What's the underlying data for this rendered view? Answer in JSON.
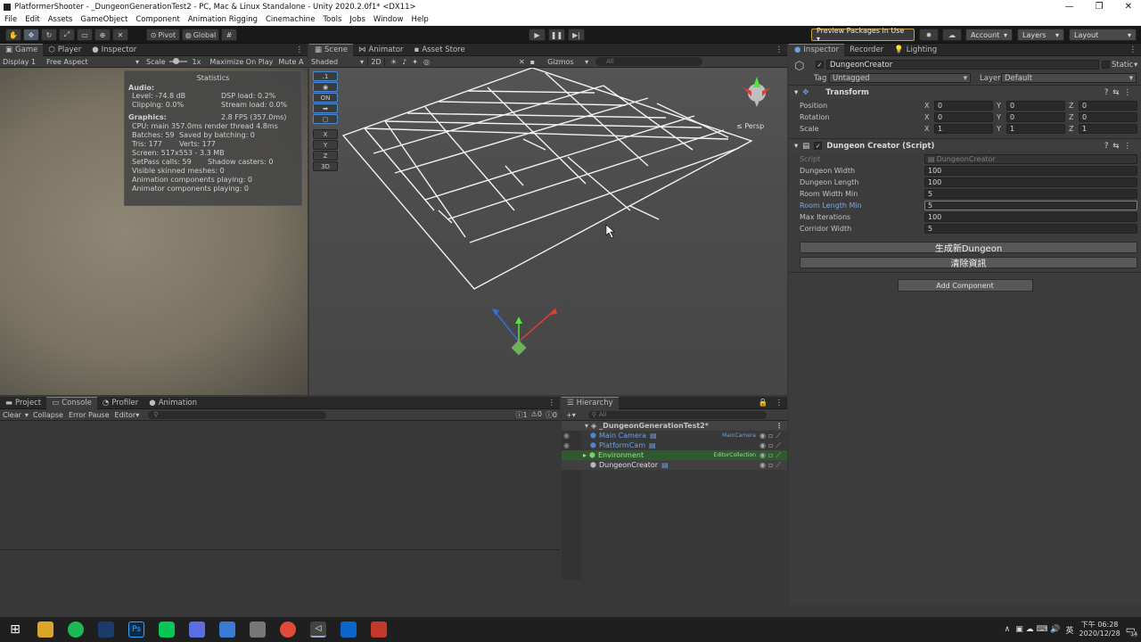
{
  "window": {
    "title": "PlatformerShooter - _DungeonGenerationTest2 - PC, Mac & Linux Standalone - Unity 2020.2.0f1* <DX11>",
    "controls": [
      "—",
      "❐",
      "✕"
    ]
  },
  "menu": [
    "File",
    "Edit",
    "Assets",
    "GameObject",
    "Component",
    "Animation Rigging",
    "Cinemachine",
    "Tools",
    "Jobs",
    "Window",
    "Help"
  ],
  "toolbar": {
    "pivot": "Pivot",
    "global": "Global",
    "preview_packages": "Preview Packages in Use ▾",
    "account": "Account",
    "layers": "Layers",
    "layout": "Layout"
  },
  "game_panel": {
    "tabs": [
      "Game",
      "Player",
      "Inspector"
    ],
    "display": "Display 1",
    "aspect": "Free Aspect",
    "scale_label": "Scale",
    "scale_value": "1x",
    "maximize": "Maximize On Play",
    "mute": "Mute A"
  },
  "stats": {
    "title": "Statistics",
    "audio_header": "Audio:",
    "level": "Level: -74.8 dB",
    "dsp_load": "DSP load: 0.2%",
    "clipping": "Clipping: 0.0%",
    "stream_load": "Stream load: 0.0%",
    "graphics_header": "Graphics:",
    "fps": "2.8 FPS (357.0ms)",
    "cpu": "CPU: main 357.0ms  render thread 4.8ms",
    "batches": "Batches: 59",
    "saved_batching": "Saved by batching: 0",
    "tris": "Tris: 177",
    "verts": "Verts: 177",
    "screen": "Screen: 517x553 - 3.3 MB",
    "setpass": "SetPass calls: 59",
    "shadow_casters": "Shadow casters: 0",
    "skinned": "Visible skinned meshes: 0",
    "anim_components": "Animation components playing: 0",
    "animator_components": "Animator components playing: 0"
  },
  "scene_panel": {
    "tabs": [
      "Scene",
      "Animator",
      "Asset Store"
    ],
    "shading": "Shaded",
    "mode_2d": "2D",
    "gizmos": "Gizmos",
    "search_placeholder": "All",
    "persp": "≤ Persp",
    "side_buttons": [
      ".1",
      "ON",
      "X",
      "Y",
      "Z",
      "3D"
    ]
  },
  "inspector": {
    "tabs": [
      "Inspector",
      "Recorder",
      "Lighting"
    ],
    "object_name": "DungeonCreator",
    "static_label": "Static",
    "tag_label": "Tag",
    "tag_value": "Untagged",
    "layer_label": "Layer",
    "layer_value": "Default",
    "transform": {
      "title": "Transform",
      "rows": [
        {
          "label": "Position",
          "x": "0",
          "y": "0",
          "z": "0"
        },
        {
          "label": "Rotation",
          "x": "0",
          "y": "0",
          "z": "0"
        },
        {
          "label": "Scale",
          "x": "1",
          "y": "1",
          "z": "1"
        }
      ]
    },
    "script_component": {
      "title": "Dungeon Creator (Script)",
      "script_label": "Script",
      "script_value": "DungeonCreator",
      "fields": [
        {
          "label": "Dungeon Width",
          "value": "100"
        },
        {
          "label": "Dungeon Length",
          "value": "100"
        },
        {
          "label": "Room Width Min",
          "value": "5"
        },
        {
          "label": "Room Length Min",
          "value": "5"
        },
        {
          "label": "Max Iterations",
          "value": "100"
        },
        {
          "label": "Corridor Width",
          "value": "5"
        }
      ],
      "generate_button": "生成新Dungeon",
      "clear_button": "清除資訊"
    },
    "add_component": "Add Component"
  },
  "console_panel": {
    "tabs": [
      "Project",
      "Console",
      "Profiler",
      "Animation"
    ],
    "clear": "Clear",
    "collapse": "Collapse",
    "error_pause": "Error Pause",
    "editor": "Editor",
    "count_info": "1",
    "count_warn": "0",
    "count_error": "0"
  },
  "hierarchy": {
    "title": "Hierarchy",
    "search_placeholder": "All",
    "scene": "_DungeonGenerationTest2*",
    "items": [
      {
        "name": "Main Camera",
        "tag": "MainCamera"
      },
      {
        "name": "PlatformCam",
        "tag": ""
      },
      {
        "name": "Environment",
        "tag": "EditorCollection"
      },
      {
        "name": "DungeonCreator",
        "tag": ""
      }
    ]
  },
  "taskbar": {
    "time": "下午 06:28",
    "date": "2020/12/28",
    "ime": "英",
    "notif_count": "14"
  }
}
